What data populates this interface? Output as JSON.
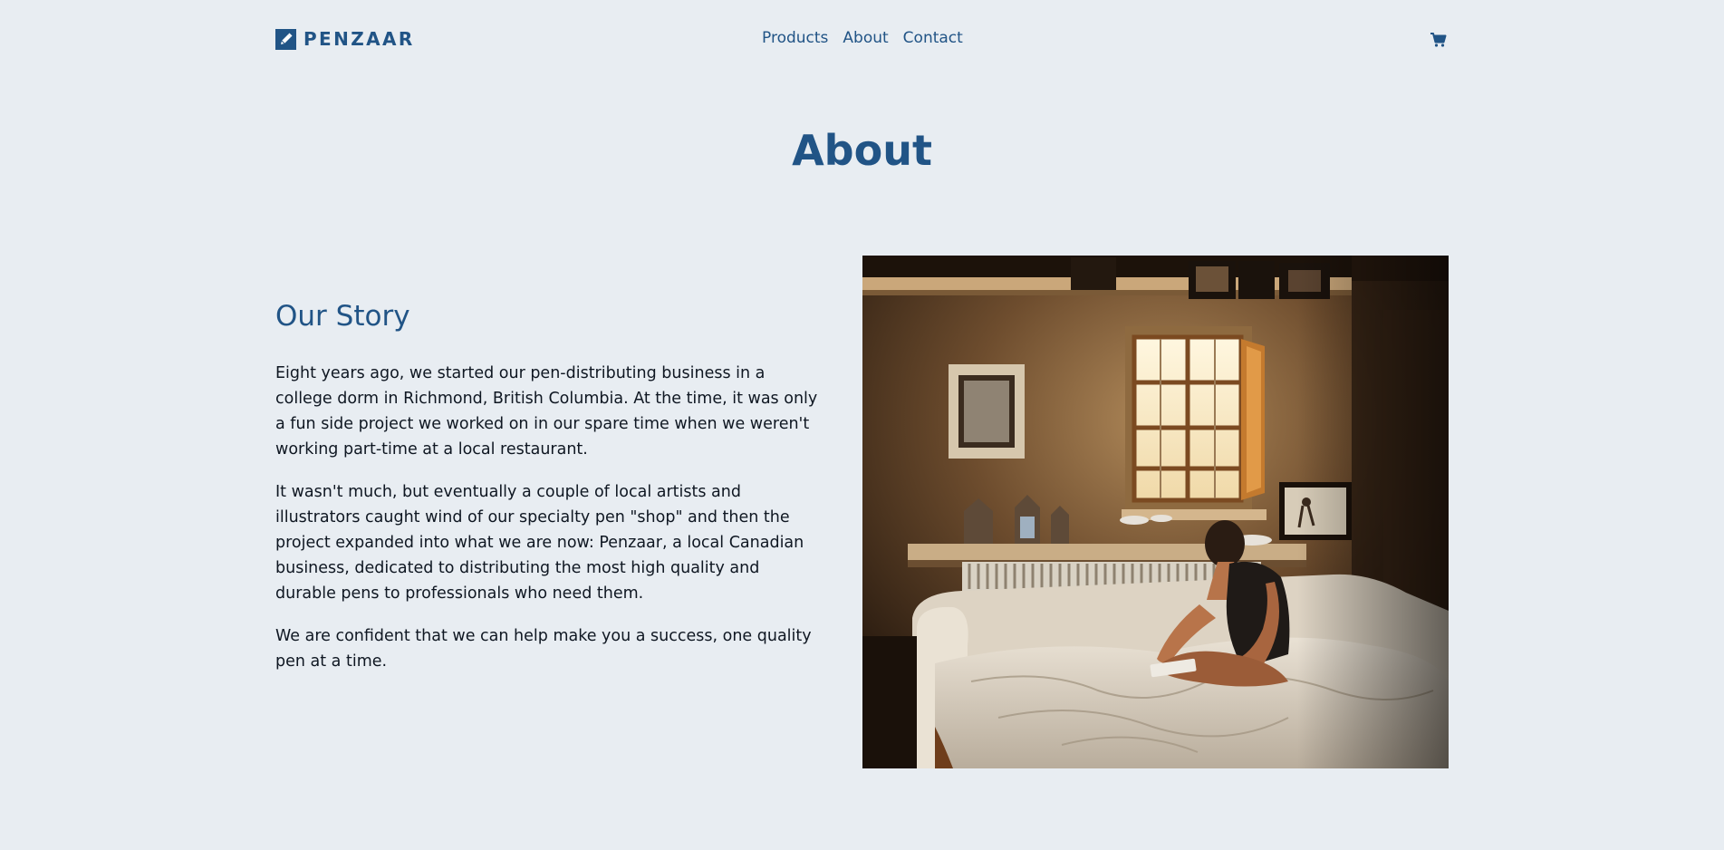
{
  "brand": {
    "name": "PENZAAR",
    "logo_icon": "pen-logo-icon"
  },
  "nav": {
    "items": [
      {
        "label": "Products"
      },
      {
        "label": "About"
      },
      {
        "label": "Contact"
      }
    ],
    "cart_icon": "cart-icon"
  },
  "page": {
    "title": "About"
  },
  "story": {
    "heading": "Our Story",
    "paragraphs": [
      "Eight years ago, we started our pen-distributing business in a college dorm in Richmond, British Columbia. At the time, it was only a fun side project we worked on in our spare time when we weren't working part-time at a local restaurant.",
      "It wasn't much, but eventually a couple of local artists and illustrators caught wind of our specialty pen \"shop\" and then the project expanded into what we are now: Penzaar, a local Canadian business, dedicated to distributing the most high quality and durable pens to professionals who need them.",
      "We are confident that we can help make you a success, one quality pen at a time."
    ]
  },
  "photo": {
    "subject": "person-sitting-on-bed-in-sunlit-room"
  },
  "colors": {
    "background": "#e8edf2",
    "brand": "#215486",
    "text": "#0f1722"
  }
}
